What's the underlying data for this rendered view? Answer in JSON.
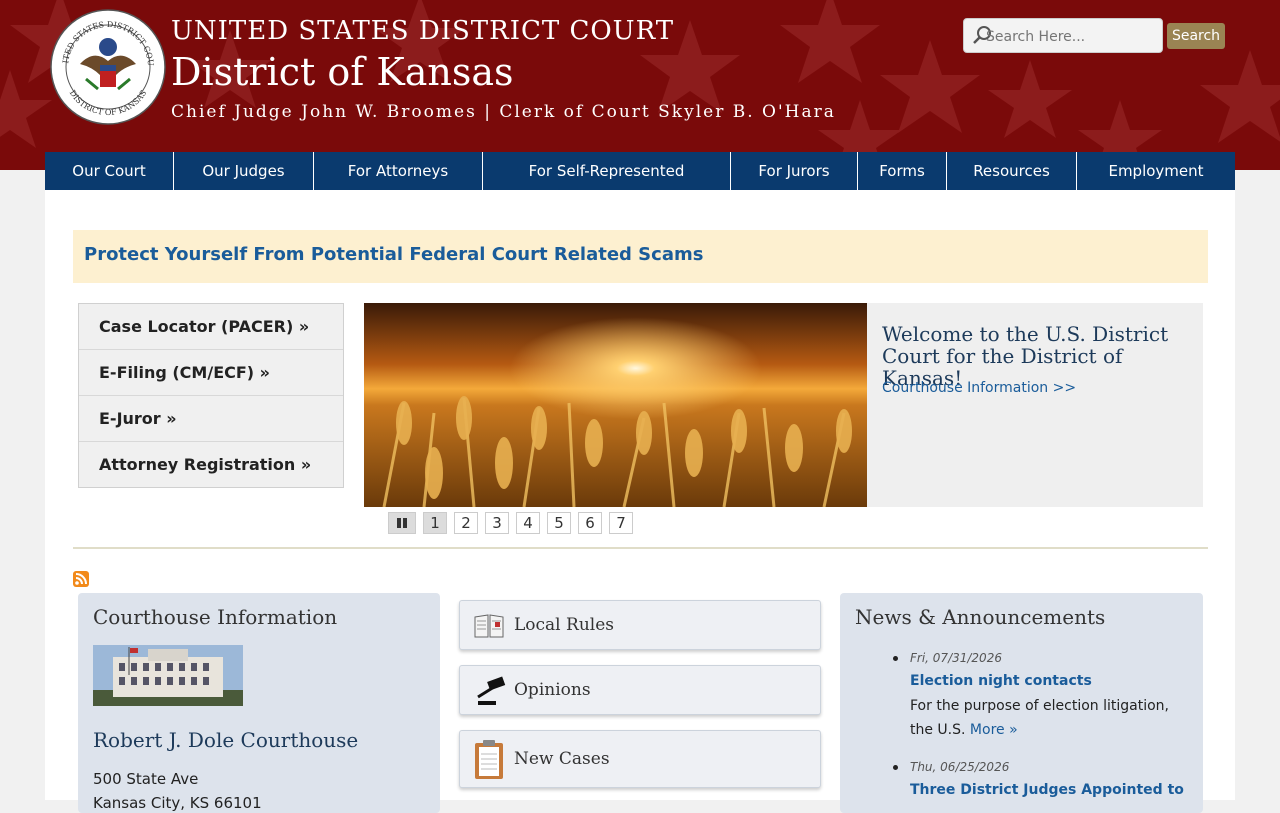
{
  "header": {
    "line1": "UNITED STATES DISTRICT COURT",
    "line2": "District of Kansas",
    "line3": "Chief Judge John W. Broomes | Clerk of Court Skyler B. O'Hara",
    "seal_text_top": "UNITED STATES DISTRICT COURT",
    "seal_text_bottom": "DISTRICT OF KANSAS",
    "search_placeholder": "Search Here...",
    "search_button": "Search"
  },
  "nav": {
    "items": [
      {
        "label": "Our Court"
      },
      {
        "label": "Our Judges"
      },
      {
        "label": "For Attorneys"
      },
      {
        "label": "For Self-Represented"
      },
      {
        "label": "For Jurors"
      },
      {
        "label": "Forms"
      },
      {
        "label": "Resources"
      },
      {
        "label": "Employment"
      }
    ]
  },
  "alert": {
    "text": "Protect Yourself From Potential Federal Court Related Scams"
  },
  "quicklinks": [
    {
      "label": "Case Locator (PACER) »"
    },
    {
      "label": "E-Filing (CM/ECF) »"
    },
    {
      "label": "E-Juror »"
    },
    {
      "label": "Attorney Registration »"
    }
  ],
  "slideshow": {
    "welcome": "Welcome to the U.S. District Court for the District of Kansas!",
    "link": "Courthouse Information >>",
    "pages": [
      "1",
      "2",
      "3",
      "4",
      "5",
      "6",
      "7"
    ]
  },
  "courthouse": {
    "title": "Courthouse Information",
    "name": "Robert J. Dole Courthouse",
    "address1": "500 State Ave",
    "address2": "Kansas City, KS 66101"
  },
  "buttons": [
    {
      "label": "Local Rules",
      "icon": "book-icon"
    },
    {
      "label": "Opinions",
      "icon": "gavel-icon"
    },
    {
      "label": "New Cases",
      "icon": "clipboard-icon"
    }
  ],
  "news": {
    "title": "News & Announcements",
    "items": [
      {
        "date": "Fri, 07/31/2026",
        "title": "Election night contacts",
        "body": "For the purpose of election litigation, the U.S.",
        "more": "More »"
      },
      {
        "date": "Thu, 06/25/2026",
        "title": "Three District Judges Appointed to"
      }
    ]
  },
  "colors": {
    "header_bg": "#7a0a0a",
    "nav_bg": "#0a3a6e",
    "link": "#1a5c9a",
    "alert_bg": "#fdf0d0",
    "search_button_bg": "#9a8453"
  }
}
